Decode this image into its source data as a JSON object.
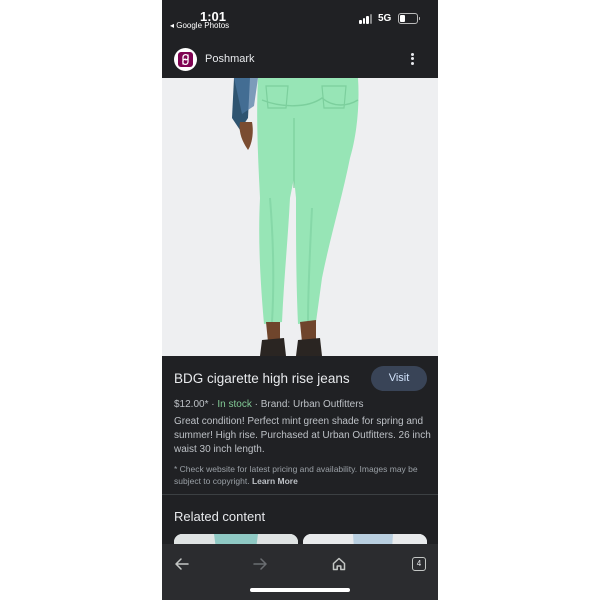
{
  "status_bar": {
    "time": "1:01",
    "back_app": "◂ Google Photos",
    "network": "5G"
  },
  "source": {
    "name": "Poshmark",
    "brand_color": "#7f0353"
  },
  "product": {
    "title": "BDG cigarette high rise jeans",
    "visit_label": "Visit",
    "price": "$12.00*",
    "stock": "In stock",
    "brand": "Brand: Urban Outfitters",
    "description": "Great condition! Perfect mint green shade for spring and summer! High rise. Purchased at Urban Outfitters. 26 inch waist 30 inch length.",
    "disclaimer": "* Check website for latest pricing and availability. Images may be subject to copyright.",
    "learn_more": "Learn More",
    "image_subject": "mint green cigarette jeans"
  },
  "related": {
    "heading": "Related content"
  },
  "bottom_nav": {
    "tab_count": "4",
    "icons": [
      "back-arrow-icon",
      "forward-arrow-icon",
      "home-icon",
      "tab-switcher-icon"
    ]
  },
  "colors": {
    "background": "#202124",
    "visit_button": "#394457",
    "in_stock": "#81c995",
    "jeans": "#97e5b6"
  }
}
